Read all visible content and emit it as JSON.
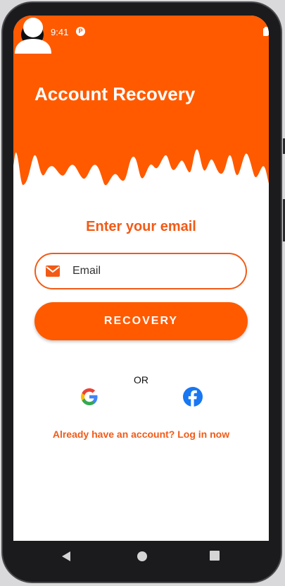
{
  "status_bar": {
    "time": "9:41",
    "app_badge": "P"
  },
  "header": {
    "title": "Account Recovery",
    "background_color": "#ff5a00"
  },
  "form": {
    "heading": "Enter your email",
    "email_placeholder": "Email",
    "email_value": "",
    "submit_label": "RECOVERY"
  },
  "social": {
    "divider_text": "OR",
    "providers": [
      "google-icon",
      "facebook-icon"
    ]
  },
  "footer": {
    "login_link": "Already have an account? Log in now"
  },
  "colors": {
    "accent": "#ff5a00",
    "accent_text": "#f25a16",
    "facebook": "#1877f2"
  }
}
